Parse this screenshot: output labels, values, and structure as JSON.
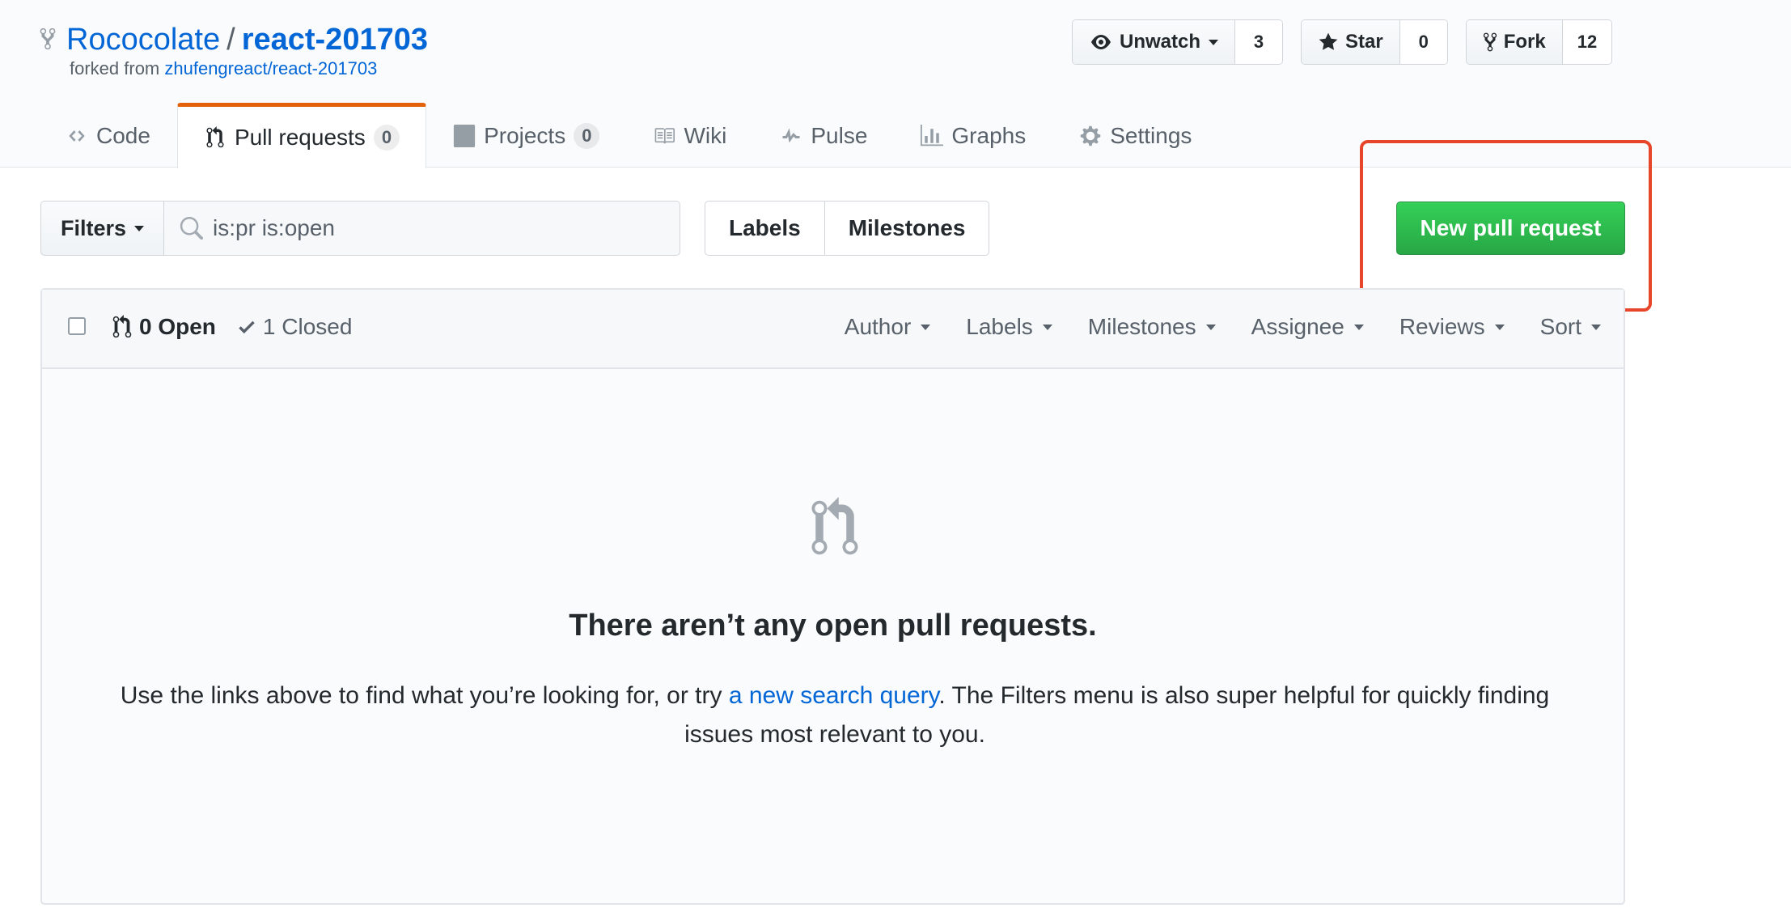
{
  "repo": {
    "owner": "Rococolate",
    "separator": "/",
    "name": "react-201703",
    "forked_from_prefix": "forked from ",
    "forked_from_link": "zhufengreact/react-201703"
  },
  "actions": {
    "watch": {
      "label": "Unwatch",
      "count": "3"
    },
    "star": {
      "label": "Star",
      "count": "0"
    },
    "fork": {
      "label": "Fork",
      "count": "12"
    }
  },
  "nav": {
    "code": "Code",
    "pulls": "Pull requests",
    "pulls_count": "0",
    "projects": "Projects",
    "projects_count": "0",
    "wiki": "Wiki",
    "pulse": "Pulse",
    "graphs": "Graphs",
    "settings": "Settings"
  },
  "subnav": {
    "filters": "Filters",
    "search_value": "is:pr is:open",
    "labels": "Labels",
    "milestones": "Milestones",
    "new_pr": "New pull request"
  },
  "list": {
    "open": "0 Open",
    "closed": "1 Closed",
    "author": "Author",
    "labels": "Labels",
    "milestones": "Milestones",
    "assignee": "Assignee",
    "reviews": "Reviews",
    "sort": "Sort"
  },
  "blankslate": {
    "title": "There aren’t any open pull requests.",
    "text_before": "Use the links above to find what you’re looking for, or try ",
    "link": "a new search query",
    "text_after": ". The Filters menu is also super helpful for quickly finding issues most relevant to you."
  },
  "colors": {
    "accent_link": "#0366d6",
    "new_pr_green": "#28a745",
    "selected_tab": "#e36209",
    "highlight_red": "#e8462a"
  }
}
